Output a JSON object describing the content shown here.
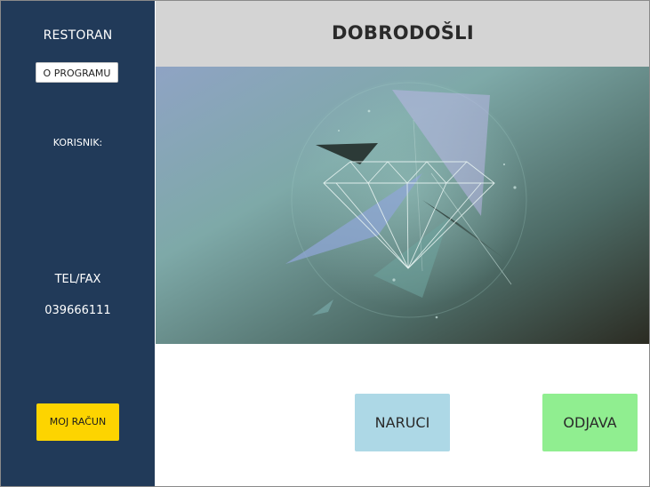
{
  "sidebar": {
    "app_title": "RESTORAN",
    "about_button": "O PROGRAMU",
    "user_label": "KORISNIK:",
    "tel_label": "TEL/FAX",
    "tel_value": "039666111",
    "account_button": "MOJ RAČUN"
  },
  "header": {
    "title": "DOBRODOŠLI"
  },
  "actions": {
    "order_button": "NARUCI",
    "logout_button": "ODJAVA"
  },
  "colors": {
    "sidebar_bg": "#213a59",
    "header_bg": "#d4d4d4",
    "account_button": "#fdd400",
    "order_button": "#add8e6",
    "logout_button": "#90ee90"
  }
}
